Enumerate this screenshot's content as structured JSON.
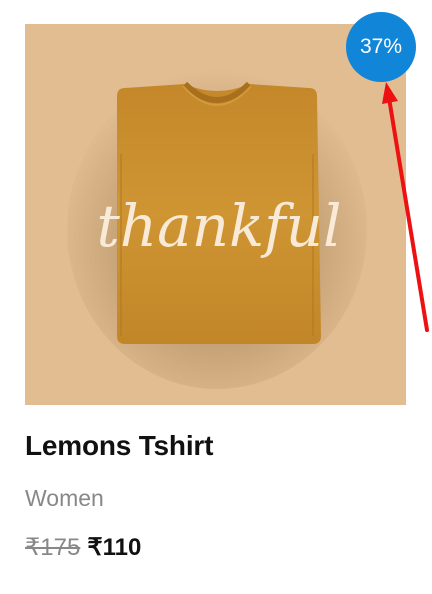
{
  "product": {
    "image_alt": "thankful",
    "image_print_text": "thankful",
    "discount_badge": "37%",
    "title": "Lemons Tshirt",
    "category": "Women",
    "price_original": "₹175",
    "price_sale": "₹110"
  },
  "colors": {
    "image_background": "#e2bd91",
    "tshirt": "#c98f2e",
    "badge": "#1185d8",
    "arrow": "#ee1111"
  },
  "icons": {
    "annotation": "red-arrow-icon"
  }
}
